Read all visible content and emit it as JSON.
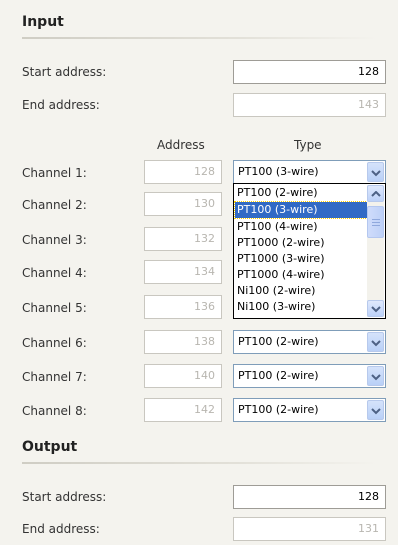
{
  "input": {
    "title": "Input",
    "start_address_label": "Start address:",
    "start_address_value": "128",
    "end_address_label": "End address:",
    "end_address_value": "143",
    "col_address": "Address",
    "col_type": "Type",
    "channels": [
      {
        "label": "Channel 1:",
        "address": "128",
        "type": "PT100 (3-wire)"
      },
      {
        "label": "Channel 2:",
        "address": "130",
        "type": ""
      },
      {
        "label": "Channel 3:",
        "address": "132",
        "type": ""
      },
      {
        "label": "Channel 4:",
        "address": "134",
        "type": ""
      },
      {
        "label": "Channel 5:",
        "address": "136",
        "type": ""
      },
      {
        "label": "Channel 6:",
        "address": "138",
        "type": "PT100 (2-wire)"
      },
      {
        "label": "Channel 7:",
        "address": "140",
        "type": "PT100 (2-wire)"
      },
      {
        "label": "Channel 8:",
        "address": "142",
        "type": "PT100 (2-wire)"
      }
    ],
    "dropdown_options": [
      "PT100 (2-wire)",
      "PT100 (3-wire)",
      "PT100 (4-wire)",
      "PT1000 (2-wire)",
      "PT1000 (3-wire)",
      "PT1000 (4-wire)",
      "Ni100 (2-wire)",
      "Ni100 (3-wire)"
    ],
    "dropdown_selected_index": 1
  },
  "output": {
    "title": "Output",
    "start_address_label": "Start address:",
    "start_address_value": "128",
    "end_address_label": "End address:",
    "end_address_value": "131"
  },
  "colors": {
    "selection": "#316ac5",
    "background": "#f4f3ee"
  }
}
